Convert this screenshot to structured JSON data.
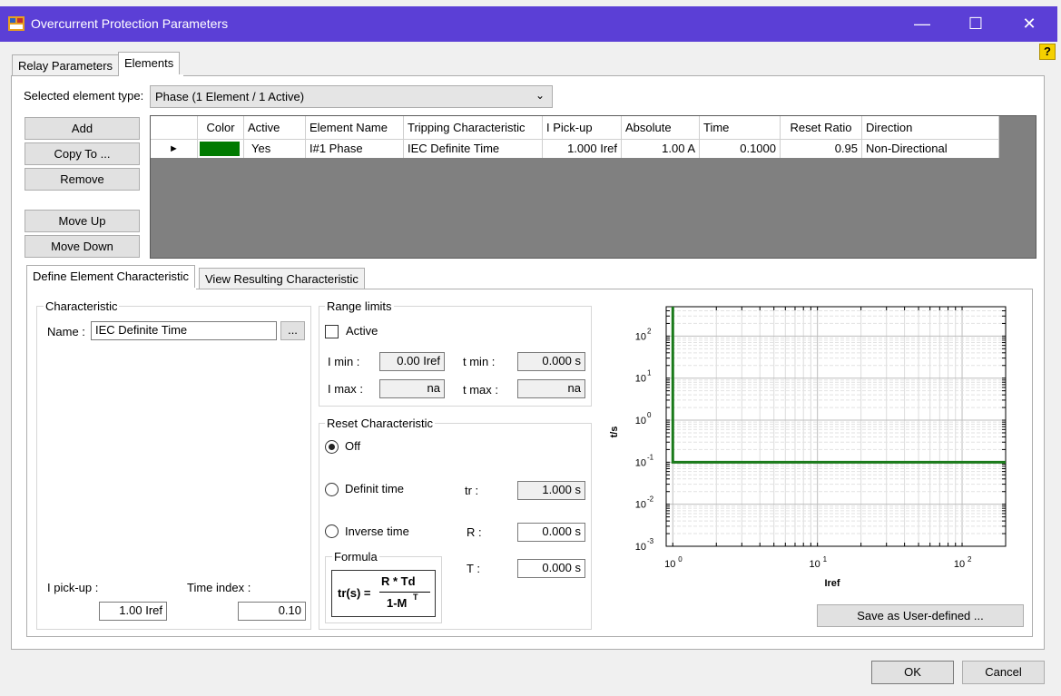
{
  "window": {
    "title": "Overcurrent Protection Parameters",
    "help_label": "?"
  },
  "tabs": {
    "relay_parameters": "Relay Parameters",
    "elements": "Elements"
  },
  "element_type": {
    "label": "Selected element type:",
    "value": "Phase (1 Element / 1 Active)"
  },
  "side_buttons": {
    "add": "Add",
    "copy_to": "Copy To ...",
    "remove": "Remove",
    "move_up": "Move Up",
    "move_down": "Move Down"
  },
  "table": {
    "columns": [
      "Color",
      "Active",
      "Element Name",
      "Tripping Characteristic",
      "I Pick-up",
      "Absolute",
      "Time",
      "Reset Ratio",
      "Direction"
    ],
    "rows": [
      {
        "marker": "►",
        "color": "#007a00",
        "active": "Yes",
        "element_name": "I#1 Phase",
        "tripping": "IEC Definite Time",
        "pickup": "1.000 Iref",
        "absolute": "1.00 A",
        "time": "0.1000",
        "reset_ratio": "0.95",
        "direction": "Non-Directional"
      }
    ]
  },
  "subtabs": {
    "define": "Define Element Characteristic",
    "view": "View Resulting Characteristic"
  },
  "characteristic": {
    "group_label": "Characteristic",
    "name_label": "Name :",
    "name_value": "IEC Definite Time",
    "browse_label": "...",
    "pickup_label": "I pick-up :",
    "pickup_value": "1.00 Iref",
    "time_index_label": "Time index :",
    "time_index_value": "0.10"
  },
  "range_limits": {
    "group_label": "Range limits",
    "active_label": "Active",
    "imin_label": "I min :",
    "imin_value": "0.00 Iref",
    "tmin_label": "t min :",
    "tmin_value": "0.000 s",
    "imax_label": "I max :",
    "imax_value": "na",
    "tmax_label": "t max :",
    "tmax_value": "na"
  },
  "reset": {
    "group_label": "Reset Characteristic",
    "off_label": "Off",
    "definit_label": "Definit time",
    "inverse_label": "Inverse time",
    "tr_label": "tr :",
    "tr_value": "1.000 s",
    "r_label": "R :",
    "r_value": "0.000 s",
    "t_label": "T :",
    "t_value": "0.000 s",
    "formula_label": "Formula",
    "formula_lhs": "tr(s) =",
    "formula_num": "R * Td",
    "formula_den": "1-M",
    "formula_exp": "T"
  },
  "plot": {
    "ylabel": "t/s",
    "xlabel": "Iref",
    "y_ticks": [
      {
        "base": "10",
        "exp": "2"
      },
      {
        "base": "10",
        "exp": "1"
      },
      {
        "base": "10",
        "exp": "0"
      },
      {
        "base": "10",
        "exp": "-1"
      },
      {
        "base": "10",
        "exp": "-2"
      },
      {
        "base": "10",
        "exp": "-3"
      }
    ],
    "x_ticks": [
      {
        "base": "10",
        "exp": "0"
      },
      {
        "base": "10",
        "exp": "1"
      },
      {
        "base": "10",
        "exp": "2"
      }
    ],
    "curve_color": "#1a7a1a"
  },
  "chart_data": {
    "type": "line",
    "x_scale": "log",
    "y_scale": "log",
    "xlabel": "Iref",
    "ylabel": "t/s",
    "xlim": [
      0.9,
      200
    ],
    "ylim": [
      0.001,
      500
    ],
    "grid": true,
    "series": [
      {
        "x": [
          1,
          1,
          200
        ],
        "y": [
          500,
          0.1,
          0.1
        ]
      }
    ]
  },
  "save_button": "Save as User-defined ...",
  "ok_button": "OK",
  "cancel_button": "Cancel"
}
